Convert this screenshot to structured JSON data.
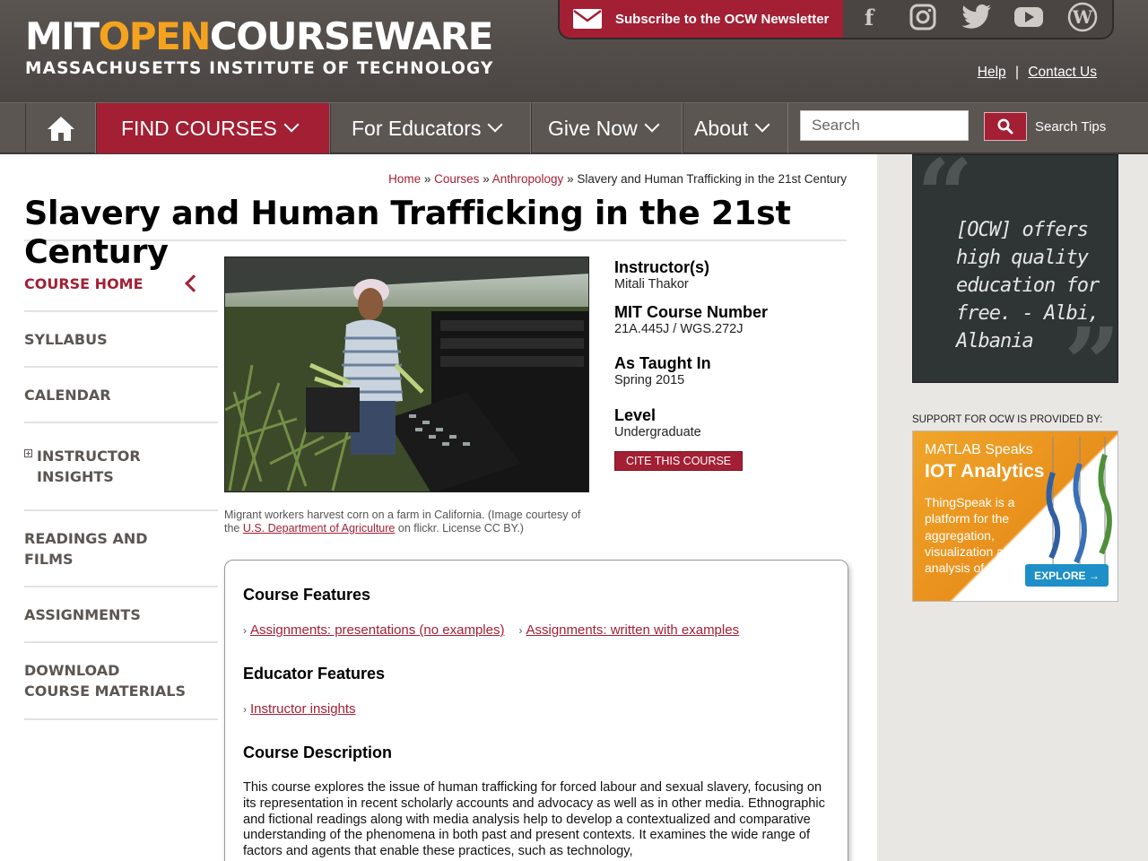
{
  "header": {
    "logo_part1": "MIT",
    "logo_part2": "OPEN",
    "logo_part3": "COURSEWARE",
    "logo_subtitle": "MASSACHUSETTS INSTITUTE OF TECHNOLOGY",
    "newsletter_label": "Subscribe to the OCW Newsletter",
    "help_label": "Help",
    "separator": "|",
    "contact_label": "Contact Us",
    "social_icons": [
      "facebook-icon",
      "instagram-icon",
      "twitter-icon",
      "youtube-icon",
      "wordpress-icon"
    ]
  },
  "nav": {
    "find_courses": "FIND COURSES",
    "for_educators": "For Educators",
    "give_now": "Give Now",
    "about": "About",
    "search_placeholder": "Search",
    "search_tips": "Search Tips"
  },
  "breadcrumb": {
    "home": "Home",
    "courses": "Courses",
    "anthropology": "Anthropology",
    "sep": "»",
    "current": "Slavery and Human Trafficking in the 21st Century"
  },
  "page_title": "Slavery and Human Trafficking in the 21st Century",
  "sidenav": {
    "items": [
      {
        "label": "COURSE HOME"
      },
      {
        "label": "SYLLABUS"
      },
      {
        "label": "CALENDAR"
      },
      {
        "label": "INSTRUCTOR INSIGHTS"
      },
      {
        "label": "READINGS AND FILMS"
      },
      {
        "label": "ASSIGNMENTS"
      },
      {
        "label": "DOWNLOAD COURSE MATERIALS"
      }
    ]
  },
  "caption": {
    "text_before": "Migrant workers harvest corn on a farm in California. (Image courtesy of the ",
    "link": "U.S. Department of Agriculture",
    "text_after": " on flickr. License CC BY.)"
  },
  "info": {
    "instructor_label": "Instructor(s)",
    "instructor": "Mitali Thakor",
    "number_label": "MIT Course Number",
    "number": "21A.445J / WGS.272J",
    "taught_label": "As Taught In",
    "taught": "Spring 2015",
    "level_label": "Level",
    "level": "Undergraduate",
    "cite_label": "CITE THIS COURSE"
  },
  "features": {
    "course_features_heading": "Course Features",
    "course_features": [
      "Assignments: presentations (no examples)",
      "Assignments: written with examples"
    ],
    "educator_features_heading": "Educator Features",
    "educator_features": [
      "Instructor insights"
    ],
    "description_heading": "Course Description",
    "description": "This course explores the issue of human trafficking for forced labour and sexual slavery, focusing on its representation in recent scholarly accounts and advocacy as well as in other media. Ethnographic and fictional readings along with media analysis help to develop a contextualized and comparative understanding of the phenomena in both past and present contexts. It examines the wide range of factors and agents that enable these practices, such as technology,"
  },
  "sidebar": {
    "quote_text": "[OCW] offers high quality education for free. - Albi, Albania",
    "support_label": "SUPPORT FOR OCW IS PROVIDED BY:",
    "ad_line1": "MATLAB Speaks",
    "ad_line2": "IOT Analytics",
    "ad_body": "ThingSpeak is a platform for the aggregation, visualization and analysis of data",
    "ad_button": "EXPLORE →"
  },
  "colors": {
    "brand_red": "#a31f34",
    "header_gray": "#5b5552",
    "logo_orange": "#f5a31e"
  }
}
